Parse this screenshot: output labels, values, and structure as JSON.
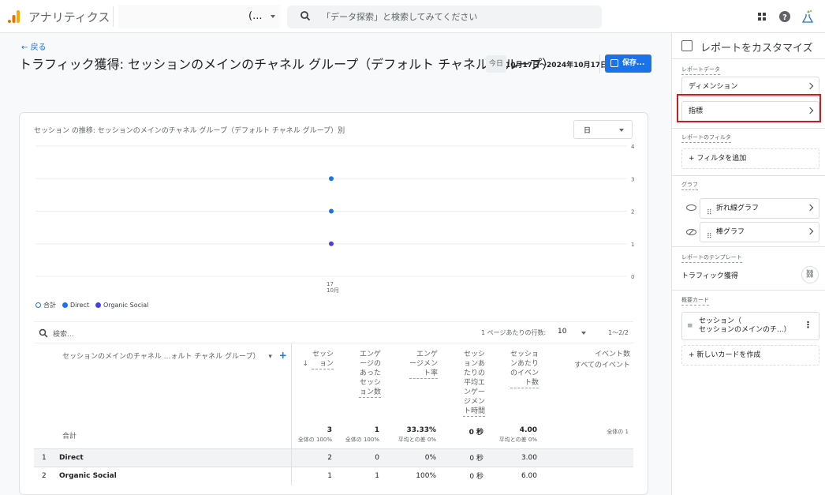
{
  "header": {
    "app_title": "アナリティクス",
    "account_label": "(...",
    "search_placeholder": "「データ探索」と検索してみてください",
    "icons": [
      "apps-grid-icon",
      "help-icon",
      "labs-flask-icon"
    ]
  },
  "page": {
    "back_label": "戻る",
    "title": "トラフィック獲得: セッションのメインのチャネル グループ（デフォルト チャネル グループ）",
    "today_label": "今日",
    "date_range": "10月17日〜2024年10月17日",
    "save_label": "保存..."
  },
  "chart": {
    "title": "セッション の推移: セッションのメインのチャネル グループ（デフォルト チャネル グループ）別",
    "granularity": "日"
  },
  "chart_data": {
    "type": "line",
    "title": "セッション の推移: セッションのメインのチャネル グループ（デフォルト チャネル グループ）別",
    "x": [
      "17\n10月"
    ],
    "x_tick_top": "17",
    "x_tick_bottom": "10月",
    "ylim": [
      0,
      4
    ],
    "y_ticks": [
      "0",
      "1",
      "2",
      "3",
      "4"
    ],
    "grid": true,
    "legend_position": "bottom-left",
    "series": [
      {
        "name": "合計",
        "values": [
          3
        ],
        "color": "#1a73e8",
        "hollow": true
      },
      {
        "name": "Direct",
        "values": [
          2
        ],
        "color": "#1a73e8"
      },
      {
        "name": "Organic Social",
        "values": [
          1
        ],
        "color": "#4b3ee0"
      }
    ]
  },
  "table": {
    "search_placeholder": "検索...",
    "rows_per_page_label": "1 ページあたりの行数:",
    "rows_per_page": "10",
    "page_range": "1〜2/2",
    "dimension_header": "セッションのメインのチャネル ...ォルト チャネル グループ）",
    "columns": [
      "セッション",
      "エンゲージのあったセッション数",
      "エンゲージメント率",
      "セッションあたりの平均エンゲージメント時間",
      "セッションあたりのイベント数",
      "イベント数"
    ],
    "last_column_sub": "すべてのイベント",
    "total": {
      "label": "合計",
      "values": [
        "3",
        "1",
        "33.33%",
        "0 秒",
        "4.00",
        ""
      ],
      "subs": [
        "全体の 100%",
        "全体の 100%",
        "平均との差 0%",
        "",
        "平均との差 0%",
        "全体の 1"
      ]
    },
    "rows": [
      {
        "index": "1",
        "name": "Direct",
        "values": [
          "2",
          "0",
          "0%",
          "0 秒",
          "3.00",
          ""
        ]
      },
      {
        "index": "2",
        "name": "Organic Social",
        "values": [
          "1",
          "1",
          "100%",
          "0 秒",
          "6.00",
          ""
        ]
      }
    ]
  },
  "sidebar": {
    "title": "レポートをカスタマイズ",
    "report_data_label": "レポートデータ",
    "dimension_label": "ディメンション",
    "metrics_label": "指標",
    "filter_section_label": "レポートのフィルタ",
    "add_filter_label": "+ フィルタを追加",
    "graph_section_label": "グラフ",
    "line_chart_label": "折れ線グラフ",
    "bar_chart_label": "棒グラフ",
    "template_section_label": "レポートのテンプレート",
    "template_name": "トラフィック獲得",
    "summary_section_label": "概要カード",
    "summary_card_line1": "セッション（",
    "summary_card_line2": "セッションのメインのチ...）",
    "new_card_label": "+ 新しいカードを作成"
  }
}
